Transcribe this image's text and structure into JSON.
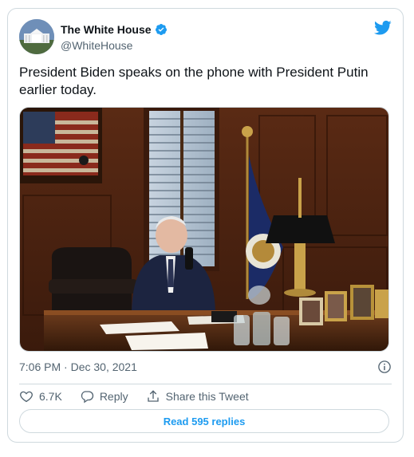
{
  "account": {
    "display_name": "The White House",
    "handle": "@WhiteHouse",
    "verified": true
  },
  "tweet": {
    "text": "President Biden speaks on the phone with President Putin earlier today.",
    "timestamp": "7:06 PM · Dec 30, 2021"
  },
  "actions": {
    "like_count": "6.7K",
    "reply_label": "Reply",
    "share_label": "Share this Tweet"
  },
  "read_replies_label": "Read 595 replies",
  "colors": {
    "accent": "#1d9bf0",
    "text_primary": "#0f1419",
    "text_secondary": "#536471",
    "border": "#cfd9de"
  },
  "icons": [
    "twitter-bird-icon",
    "verified-badge-icon",
    "info-icon",
    "heart-icon",
    "reply-icon",
    "share-icon"
  ]
}
